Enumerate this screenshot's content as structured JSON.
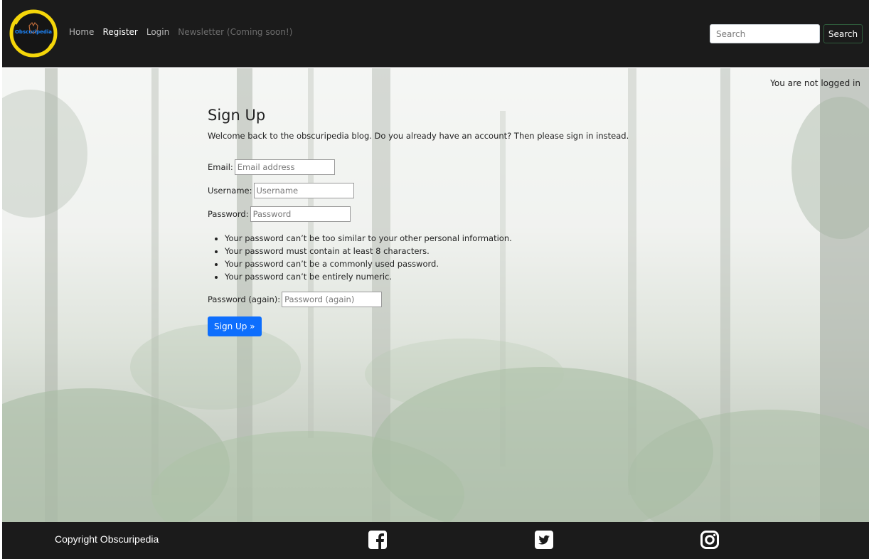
{
  "brand": {
    "logo_text": "Obscuripedia"
  },
  "nav": {
    "links": [
      {
        "label": "Home"
      },
      {
        "label": "Register"
      },
      {
        "label": "Login"
      },
      {
        "label": "Newsletter (Coming soon!)"
      }
    ],
    "search": {
      "placeholder": "Search",
      "button_label": "Search"
    }
  },
  "status": {
    "login_text": "You are not logged in"
  },
  "form": {
    "title": "Sign Up",
    "intro": "Welcome back to the obscuripedia blog. Do you already have an account? Then please sign in instead.",
    "email": {
      "label": "Email:",
      "placeholder": "Email address"
    },
    "username": {
      "label": "Username:",
      "placeholder": "Username"
    },
    "password": {
      "label": "Password:",
      "placeholder": "Password"
    },
    "rules": [
      "Your password can’t be too similar to your other personal information.",
      "Your password must contain at least 8 characters.",
      "Your password can’t be a commonly used password.",
      "Your password can’t be entirely numeric."
    ],
    "password_again": {
      "label": "Password (again):",
      "placeholder": "Password (again)"
    },
    "submit_label": "Sign Up »"
  },
  "footer": {
    "copyright": "Copyright Obscuripedia",
    "social": [
      "facebook-icon",
      "twitter-icon",
      "instagram-icon"
    ]
  },
  "colors": {
    "nav_bg": "#1b1b1b",
    "accent": "#0d6efd",
    "logo_ring": "#f5d60a"
  }
}
